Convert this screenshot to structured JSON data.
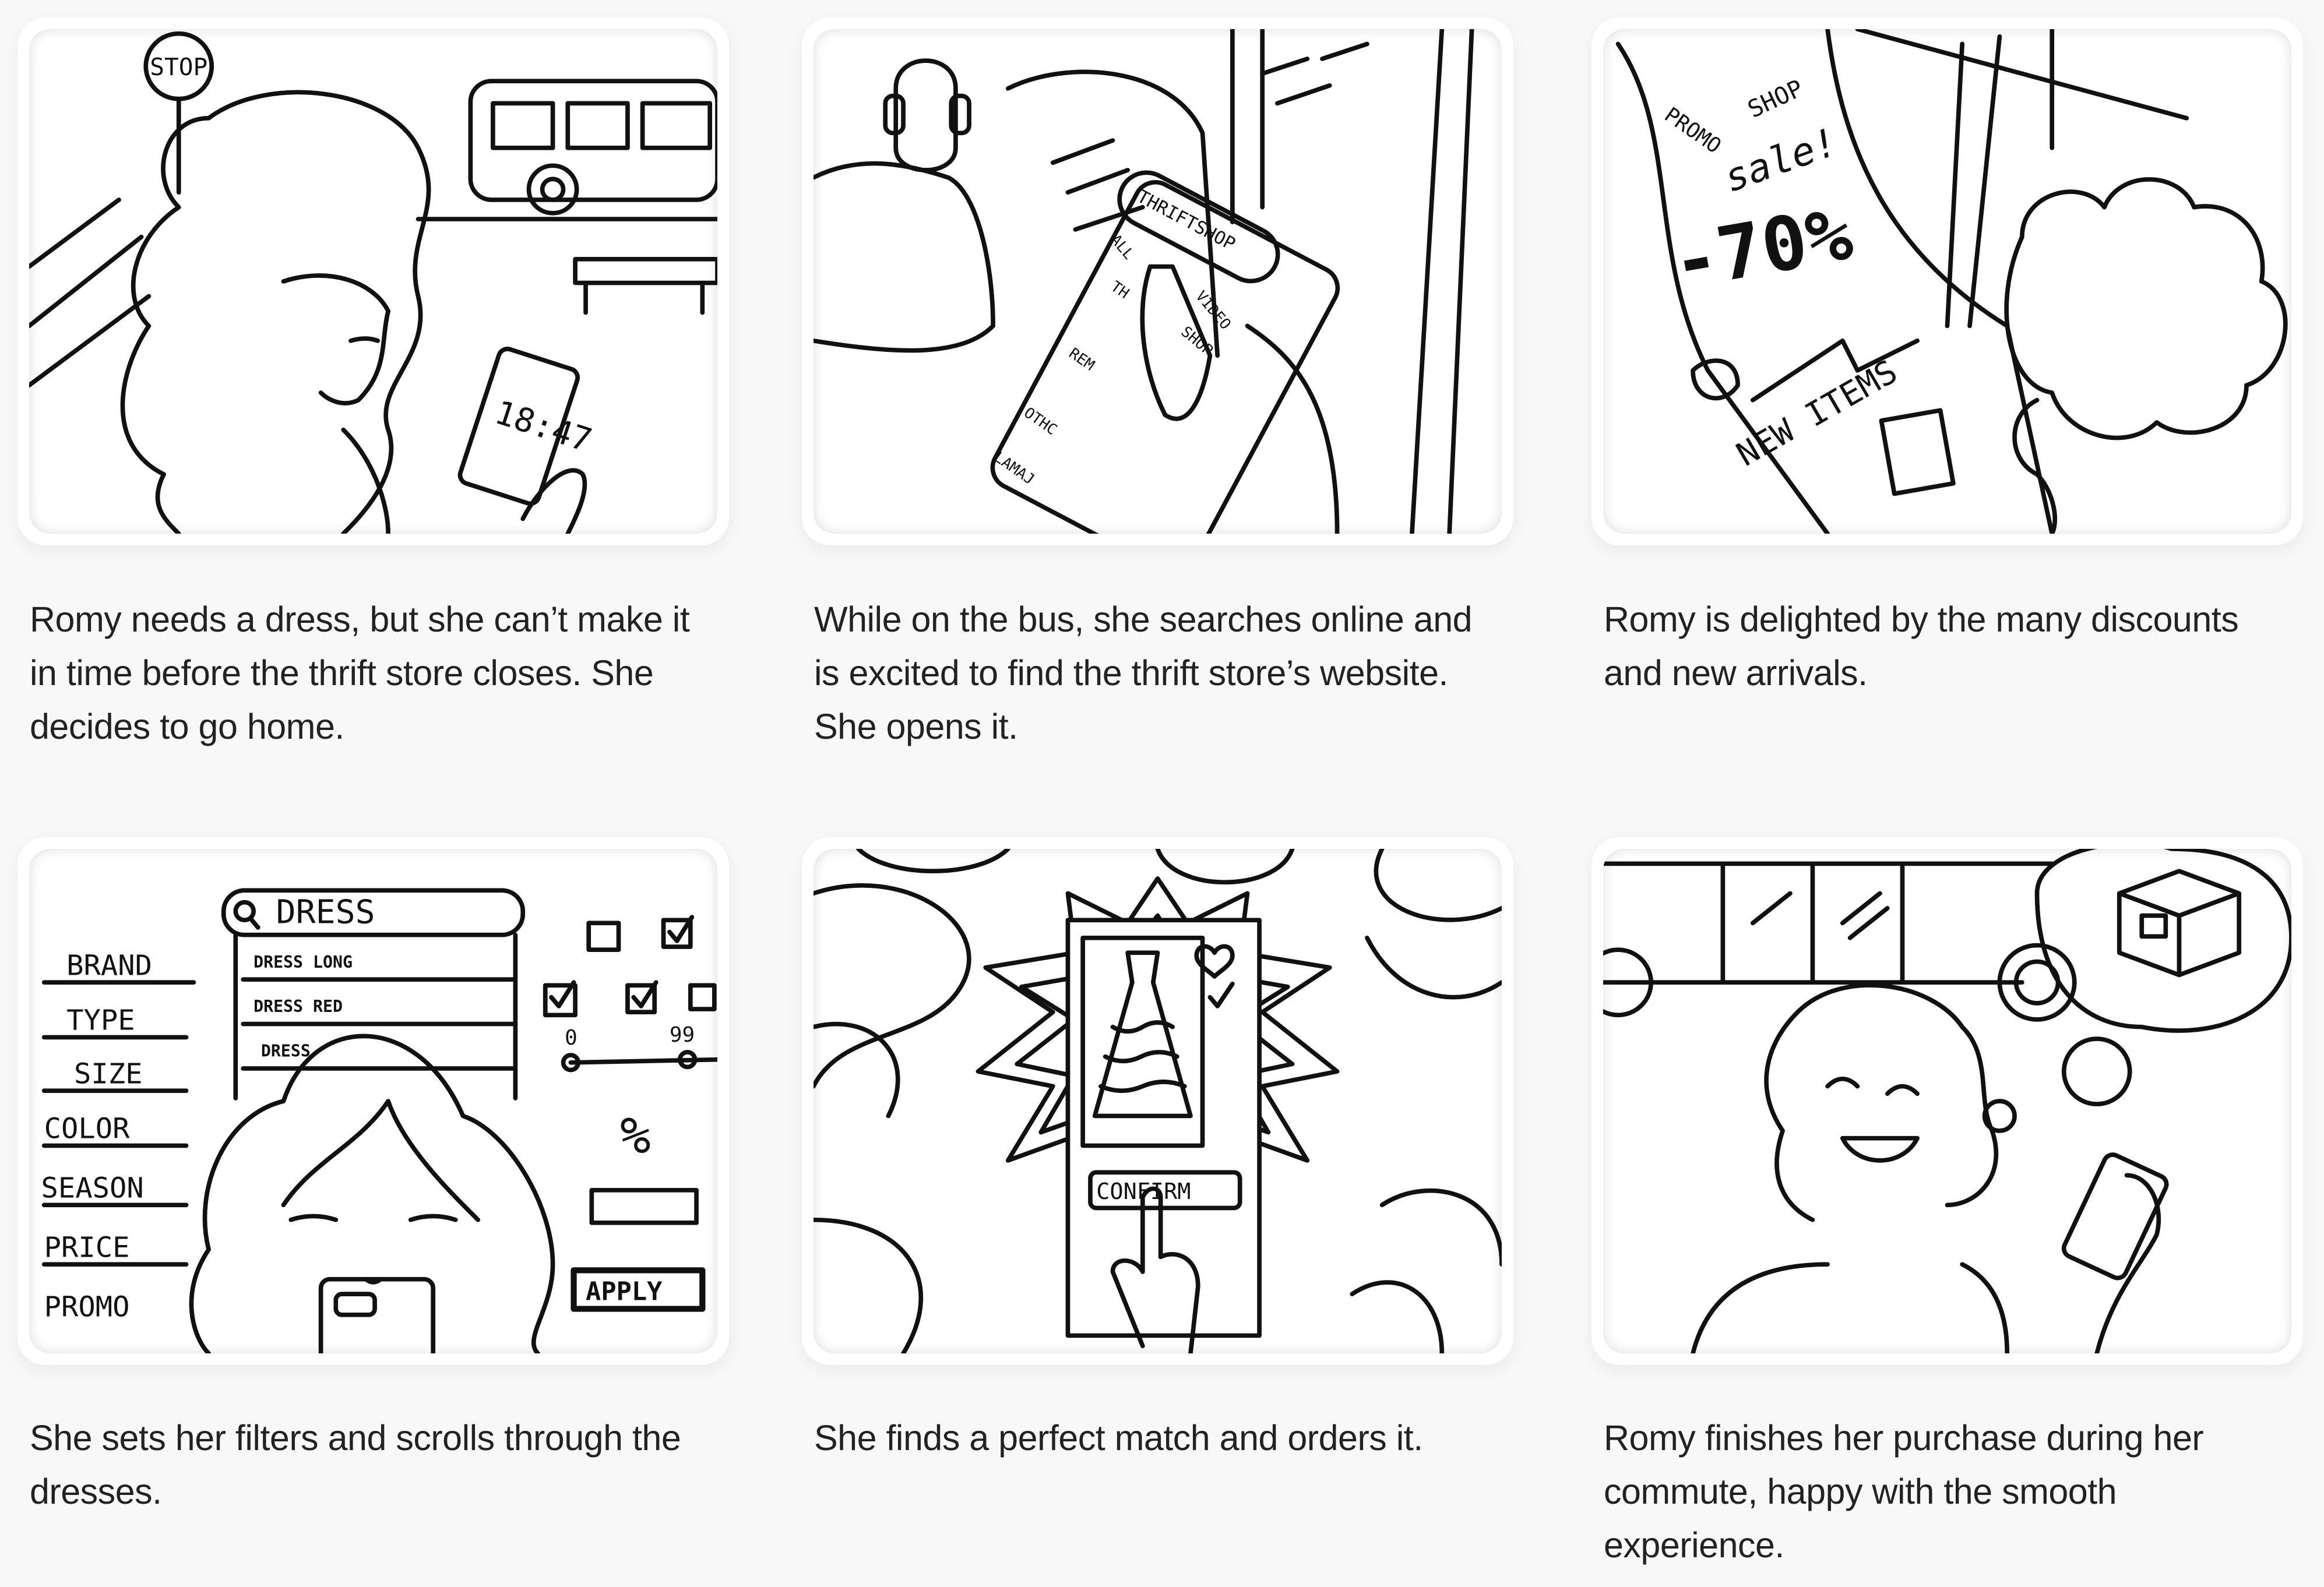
{
  "panels": [
    {
      "caption": "Romy needs a dress, but she can’t make it in time before the thrift store closes. She decides to go home.",
      "labels": {
        "sign": "STOP",
        "phone_time": "18:47"
      }
    },
    {
      "caption": "While on the bus, she searches online and is excited to find the thrift store’s website. She opens it.",
      "labels": {
        "app": "THRIFTSHOP",
        "tab": "ALL",
        "video": "VIDEO",
        "shop": "SHOP",
        "item1": "TH",
        "item2": "REM",
        "item3": "OTHC",
        "item4": "LAMAJ"
      }
    },
    {
      "caption": "Romy is delighted by the many discounts and new arrivals.",
      "labels": {
        "promo": "PROMO",
        "shop": "SHOP",
        "sale": "sale!",
        "discount": "-70%",
        "new_items": "NEW ITEMS"
      }
    },
    {
      "caption": "She sets her filters and scrolls through the dresses.",
      "labels": {
        "search": "DRESS",
        "suggestions": [
          "DRESS LONG",
          "DRESS RED",
          "DRESS"
        ],
        "filters": [
          "BRAND",
          "TYPE",
          "SIZE",
          "COLOR",
          "SEASON",
          "PRICE",
          "PROMO"
        ],
        "range_min": "0",
        "range_max": "99",
        "percent": "%",
        "apply": "APPLY"
      }
    },
    {
      "caption": "She finds a perfect match and orders it.",
      "labels": {
        "confirm": "CONFIRM"
      }
    },
    {
      "caption": "Romy finishes her purchase during her commute, happy with the smooth experience.",
      "labels": {}
    }
  ]
}
